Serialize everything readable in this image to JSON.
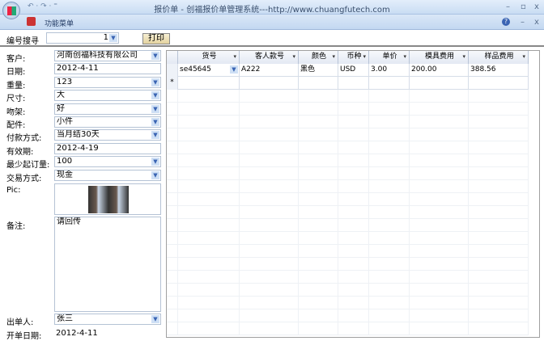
{
  "window": {
    "title": "报价单 - 创福报价单管理系统---http://www.chuangfutech.com",
    "qat": "↶ · ↷ · ⁼",
    "min": "–",
    "max": "▫",
    "close": "x"
  },
  "ribbon": {
    "menu": "功能菜单",
    "help": "?"
  },
  "toolbar": {
    "search_label": "编号搜寻",
    "search_value": "1",
    "print_label": "打印"
  },
  "form": [
    {
      "label": "客户:",
      "value": "河南创福科技有限公司",
      "dropdown": true
    },
    {
      "label": "日期:",
      "value": "2012-4-11",
      "dropdown": false
    },
    {
      "label": "重量:",
      "value": "123",
      "dropdown": true
    },
    {
      "label": "尺寸:",
      "value": "大",
      "dropdown": true
    },
    {
      "label": "吻架:",
      "value": "好",
      "dropdown": true
    },
    {
      "label": "配件:",
      "value": "小件",
      "dropdown": true
    },
    {
      "label": "付款方式:",
      "value": "当月结30天",
      "dropdown": true
    },
    {
      "label": "有效期:",
      "value": "2012-4-19",
      "dropdown": false
    },
    {
      "label": "最少起订量:",
      "value": "100",
      "dropdown": true
    },
    {
      "label": "交易方式:",
      "value": "现金",
      "dropdown": true
    }
  ],
  "pic_label": "Pic:",
  "notes": {
    "label": "备注:",
    "value": "请回传"
  },
  "issuer": {
    "label": "出单人:",
    "value": "张三"
  },
  "open_date": {
    "label": "开单日期:",
    "value": "2012-4-11"
  },
  "grid": {
    "columns": [
      "货号",
      "客人款号",
      "颜色",
      "币种",
      "单价",
      "模具费用",
      "样品费用"
    ],
    "rows": [
      [
        "se45645",
        "A222",
        "黑色",
        "USD",
        "3.00",
        "200.00",
        "388.56"
      ]
    ],
    "new_row_marker": "*"
  }
}
